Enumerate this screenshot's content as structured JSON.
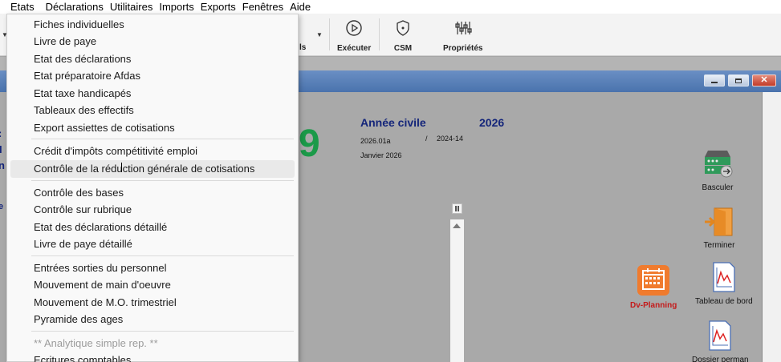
{
  "menubar": {
    "items": [
      "Etats",
      "Déclarations",
      "Utilitaires",
      "Imports",
      "Exports",
      "Fenêtres",
      "Aide"
    ]
  },
  "toolbar": {
    "partial_label": "ls",
    "execute_label": "Exécuter",
    "csm_label": "CSM",
    "properties_label": "Propriétés"
  },
  "main": {
    "annee_label": "Année civile",
    "annee_value": "2026",
    "version": "2026.01a",
    "slash": "/",
    "code": "2024-14",
    "periode": "Janvier 2026",
    "big_digit": "9"
  },
  "side": {
    "basculer": "Basculer",
    "terminer": "Terminer",
    "dv_planning": "Dv-Planning",
    "tableau_bord": "Tableau de bord",
    "dossier": "Dossier perman"
  },
  "menu": {
    "items": [
      "Fiches individuelles",
      "Livre de paye",
      "Etat des déclarations",
      "Etat préparatoire Afdas",
      "Etat taxe handicapés",
      "Tableaux des effectifs",
      "Export assiettes de cotisations",
      "Crédit d'impôts compétitivité emploi",
      "Contrôle de la réduction générale de cotisations",
      "Contrôle des bases",
      "Contrôle sur rubrique",
      "Etat des déclarations détaillé",
      "Livre de paye détaillé",
      "Entrées sorties du personnel",
      "Mouvement de main d'oeuvre",
      "Mouvement de M.O. trimestriel",
      "Pyramide des ages",
      "** Analytique simple rep. **",
      "Ecritures comptables"
    ]
  },
  "colors": {
    "accent_green": "#1b9a49",
    "navy_text": "#14257a",
    "planning_orange": "#f07b2e"
  }
}
